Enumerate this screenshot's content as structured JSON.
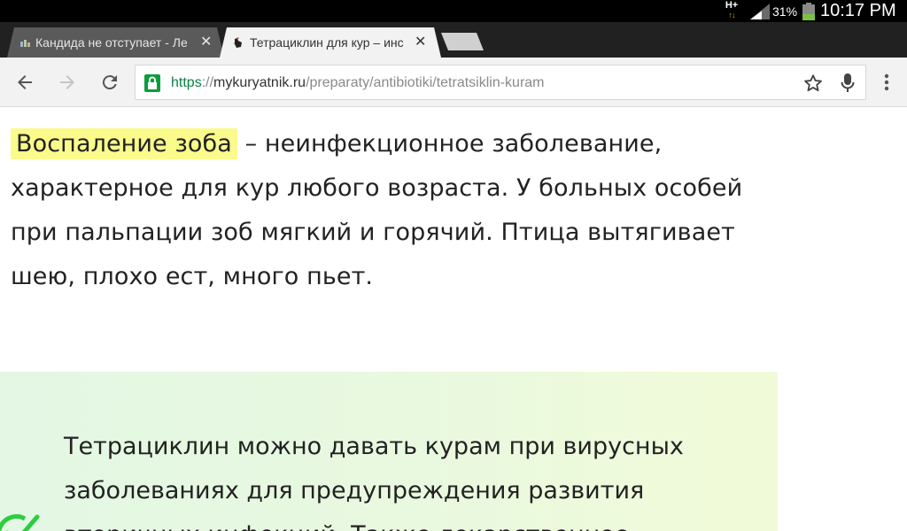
{
  "status_bar": {
    "network": "H+",
    "network_arrows": "↑↓",
    "battery_percent": "31%",
    "time": "10:17 PM"
  },
  "tabs": [
    {
      "title": "Кандида не отступает - Ле",
      "active": false,
      "favicon": "site-favicon-icon"
    },
    {
      "title": "Тетрациклин для кур – инс",
      "active": true,
      "favicon": "rooster-favicon-icon"
    }
  ],
  "tab_close_glyph": "✕",
  "toolbar": {
    "url_scheme": "https",
    "url_separator": "://",
    "url_host": "mykuryatnik.ru",
    "url_path": "/preparaty/antibiotiki/tetratsiklin-kuram"
  },
  "content": {
    "highlight": "Воспаление зоба",
    "paragraph_rest": " – неинфекционное заболевание, характерное для кур любого возраста. У больных особей при пальпации зоб мягкий и горячий. Птица вытягивает шею, плохо ест, много пьет.",
    "callout_text": "Тетрациклин можно давать курам при вирусных заболеваниях для предупреждения развития вторичных инфекций. Также лекарственное"
  },
  "colors": {
    "highlight": "#fbfb8c",
    "callout_check": "#2ecc40",
    "secure_scheme": "#0b8043"
  }
}
